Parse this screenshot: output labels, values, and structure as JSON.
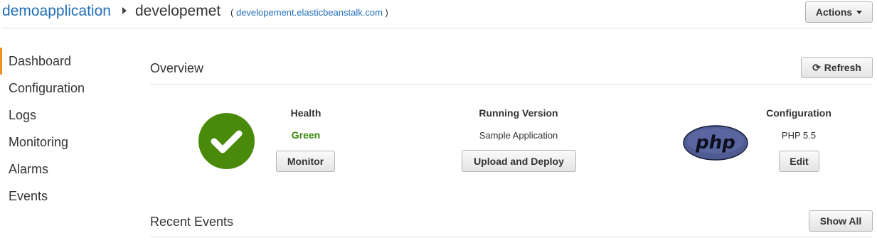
{
  "header": {
    "app_name": "demoapplication",
    "env_name": "developemet",
    "url_open": "(",
    "url": "developement.elasticbeanstalk.com",
    "url_close": ")",
    "actions_label": "Actions"
  },
  "sidebar": {
    "items": [
      {
        "label": "Dashboard",
        "active": true
      },
      {
        "label": "Configuration",
        "active": false
      },
      {
        "label": "Logs",
        "active": false
      },
      {
        "label": "Monitoring",
        "active": false
      },
      {
        "label": "Alarms",
        "active": false
      },
      {
        "label": "Events",
        "active": false
      }
    ]
  },
  "overview": {
    "title": "Overview",
    "refresh_label": "Refresh",
    "health": {
      "heading": "Health",
      "value": "Green",
      "button": "Monitor",
      "icon": "check-circle-icon",
      "color": "#4a8a0a"
    },
    "running_version": {
      "heading": "Running Version",
      "value": "Sample Application",
      "button": "Upload and Deploy"
    },
    "configuration": {
      "heading": "Configuration",
      "value": "PHP 5.5",
      "button": "Edit",
      "logo": "php",
      "logo_text": "php"
    }
  },
  "recent_events": {
    "title": "Recent Events",
    "show_all_label": "Show All"
  },
  "colors": {
    "link": "#1f6eb6",
    "active_accent": "#f0901e",
    "health_green": "#3b8a0e"
  }
}
